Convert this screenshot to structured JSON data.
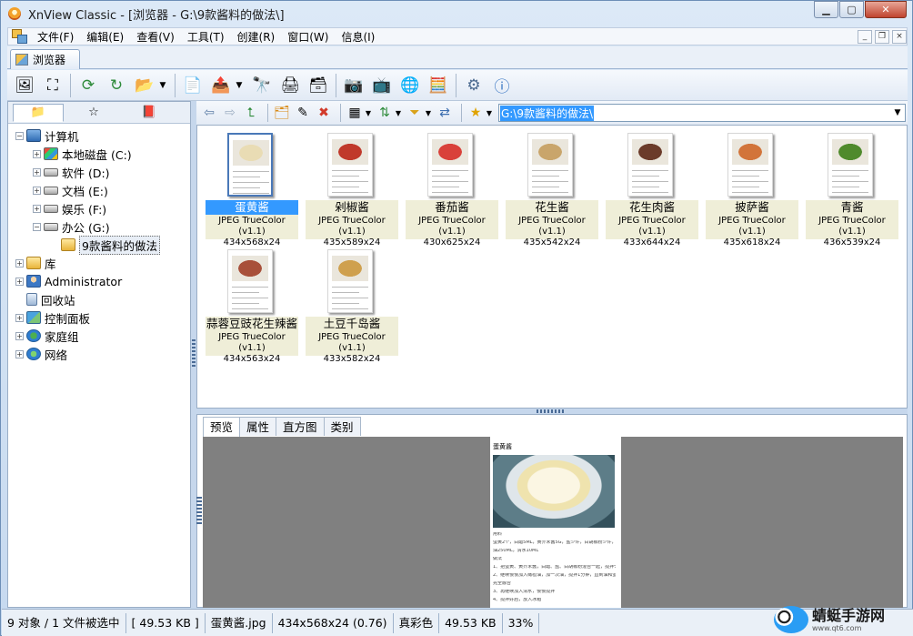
{
  "window": {
    "title": "XnView Classic - [浏览器 - G:\\9款酱料的做法\\]",
    "controls": [
      "▁",
      "▢",
      "✕"
    ]
  },
  "menu": [
    "文件(F)",
    "编辑(E)",
    "查看(V)",
    "工具(T)",
    "创建(R)",
    "窗口(W)",
    "信息(I)"
  ],
  "mdi_controls": [
    "_",
    "❐",
    "×"
  ],
  "doc_tab": "浏览器",
  "tree": [
    {
      "label": "计算机",
      "icon": "computer-icon",
      "indent": 0,
      "exp": "−"
    },
    {
      "label": "本地磁盘 (C:)",
      "icon": "windows-drive-icon",
      "indent": 1,
      "exp": "+"
    },
    {
      "label": "软件 (D:)",
      "icon": "drive-icon",
      "indent": 1,
      "exp": "+"
    },
    {
      "label": "文档 (E:)",
      "icon": "drive-icon",
      "indent": 1,
      "exp": "+"
    },
    {
      "label": "娱乐 (F:)",
      "icon": "drive-icon",
      "indent": 1,
      "exp": "+"
    },
    {
      "label": "办公 (G:)",
      "icon": "drive-icon",
      "indent": 1,
      "exp": "−"
    },
    {
      "label": "9款酱料的做法",
      "icon": "folder-icon",
      "indent": 2,
      "exp": "",
      "selected": true
    },
    {
      "label": "库",
      "icon": "library-icon",
      "indent": 0,
      "exp": "+"
    },
    {
      "label": "Administrator",
      "icon": "user-icon",
      "indent": 0,
      "exp": "+"
    },
    {
      "label": "回收站",
      "icon": "recycle-bin-icon",
      "indent": 0,
      "exp": ""
    },
    {
      "label": "控制面板",
      "icon": "control-panel-icon",
      "indent": 0,
      "exp": "+"
    },
    {
      "label": "家庭组",
      "icon": "homegroup-icon",
      "indent": 0,
      "exp": "+"
    },
    {
      "label": "网络",
      "icon": "network-icon",
      "indent": 0,
      "exp": "+"
    }
  ],
  "path": "G:\\9款酱料的做法\\",
  "thumbnails": [
    {
      "name": "蛋黄酱",
      "format": "JPEG TrueColor (v1.1)",
      "size": "434x568x24",
      "selected": true,
      "color": "#e9dcb4"
    },
    {
      "name": "剁椒酱",
      "format": "JPEG TrueColor (v1.1)",
      "size": "435x589x24",
      "color": "#c0392b"
    },
    {
      "name": "番茄酱",
      "format": "JPEG TrueColor (v1.1)",
      "size": "430x625x24",
      "color": "#d9413a"
    },
    {
      "name": "花生酱",
      "format": "JPEG TrueColor (v1.1)",
      "size": "435x542x24",
      "color": "#c9a56b"
    },
    {
      "name": "花生肉酱",
      "format": "JPEG TrueColor (v1.1)",
      "size": "433x644x24",
      "color": "#6b3b2a"
    },
    {
      "name": "披萨酱",
      "format": "JPEG TrueColor (v1.1)",
      "size": "435x618x24",
      "color": "#d2743a"
    },
    {
      "name": "青酱",
      "format": "JPEG TrueColor (v1.1)",
      "size": "436x539x24",
      "color": "#4f8a2c"
    },
    {
      "name": "蒜蓉豆豉花生辣酱",
      "format": "JPEG TrueColor (v1.1)",
      "size": "434x563x24",
      "color": "#a8503a"
    },
    {
      "name": "土豆千岛酱",
      "format": "JPEG TrueColor (v1.1)",
      "size": "433x582x24",
      "color": "#cfa04e"
    }
  ],
  "preview_tabs": [
    "预览",
    "属性",
    "直方图",
    "类别"
  ],
  "preview_doc": {
    "title": "蛋黄酱",
    "lines": [
      "用料",
      "蛋黄2个，白醋5ML，黄芥末酱5G，盐少许，白胡椒粉少许，橄榄",
      "油250ML，清水10ML",
      "做法",
      "1、把蛋黄、黄芥末酱，白醋、盐、白胡椒粉混合一起，搅拌匀",
      "2、继续慢慢加入橄榄油，加一次油，搅拌1分钟，直到油和蛋黄",
      "完全融合",
      "3、再继续加入清水，慢慢搅拌",
      "4、搅拌好后，放入冰箱"
    ]
  },
  "status": [
    "9 对象 / 1 文件被选中",
    "[ 49.53 KB ]",
    "蛋黄酱.jpg",
    "434x568x24 (0.76)",
    "真彩色",
    "49.53 KB",
    "33%"
  ],
  "watermark": {
    "text": "蜻蜓手游网",
    "sub": "www.qt6.com"
  }
}
